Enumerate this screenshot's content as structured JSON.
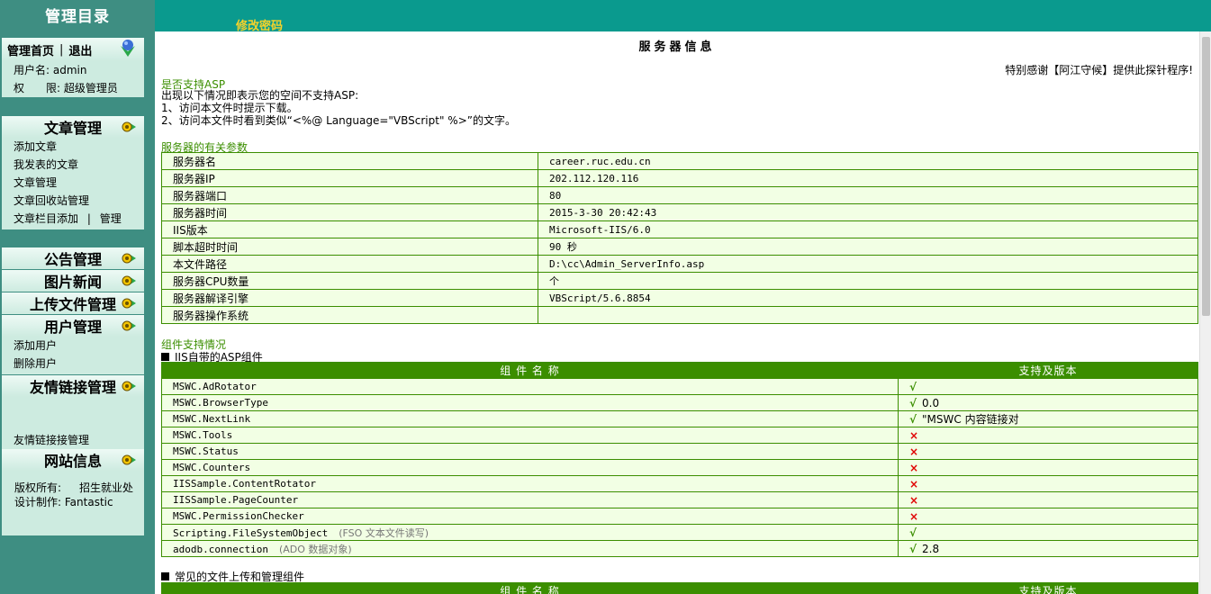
{
  "sidebar": {
    "title": "管理目录",
    "home_link": "管理首页",
    "separator": "|",
    "logout_link": "退出",
    "user_line": "用户名: admin",
    "perm_label": "权　　限: 超级管理员",
    "article_head": "文章管理",
    "article_items": [
      "添加文章",
      "我发表的文章",
      "文章管理",
      "文章回收站管理"
    ],
    "article_col_add": "文章栏目添加",
    "article_col_manage": "管理",
    "notice_head": "公告管理",
    "photo_head": "图片新闻",
    "upload_head": "上传文件管理",
    "user_head": "用户管理",
    "user_items": [
      "添加用户",
      "删除用户"
    ],
    "link_head": "友情链接管理",
    "link_items": [
      "友情链接接管理"
    ],
    "site_head": "网站信息",
    "copyright_label": "版权所有:",
    "copyright_value": "招生就业处",
    "design_label": "设计制作:",
    "design_value": "Fantastic"
  },
  "topbar": {
    "change_password": "修改密码"
  },
  "main": {
    "title": "服务器信息",
    "thanks": "特别感谢【阿江守候】提供此探针程序!",
    "asp_title": "是否支持ASP",
    "asp_lines": [
      "出现以下情况即表示您的空间不支持ASP:",
      "1、访问本文件时提示下载。",
      "2、访问本文件时看到类似“<%@ Language=\"VBScript\" %>”的文字。"
    ],
    "params_title": "服务器的有关参数",
    "params": [
      {
        "name": "服务器名",
        "value": "career.ruc.edu.cn"
      },
      {
        "name": "服务器IP",
        "value": "202.112.120.116"
      },
      {
        "name": "服务器端口",
        "value": "80"
      },
      {
        "name": "服务器时间",
        "value": "2015-3-30 20:42:43"
      },
      {
        "name": "IIS版本",
        "value": "Microsoft-IIS/6.0"
      },
      {
        "name": "脚本超时时间",
        "value": "90 秒"
      },
      {
        "name": "本文件路径",
        "value": "D:\\cc\\Admin_ServerInfo.asp"
      },
      {
        "name": "服务器CPU数量",
        "value": " 个"
      },
      {
        "name": "服务器解译引擎",
        "value": "VBScript/5.6.8854"
      },
      {
        "name": "服务器操作系统",
        "value": ""
      }
    ],
    "components_title": "组件支持情况",
    "iis_sub": "IIS自带的ASP组件",
    "col_name": "组 件 名 称",
    "col_support": "支持及版本",
    "components": [
      {
        "name": "MSWC.AdRotator",
        "note": "",
        "supported": true,
        "version": ""
      },
      {
        "name": "MSWC.BrowserType",
        "note": "",
        "supported": true,
        "version": "0.0"
      },
      {
        "name": "MSWC.NextLink",
        "note": "",
        "supported": true,
        "version": "\"MSWC 内容链接对"
      },
      {
        "name": "MSWC.Tools",
        "note": "",
        "supported": false,
        "version": ""
      },
      {
        "name": "MSWC.Status",
        "note": "",
        "supported": false,
        "version": ""
      },
      {
        "name": "MSWC.Counters",
        "note": "",
        "supported": false,
        "version": ""
      },
      {
        "name": "IISSample.ContentRotator",
        "note": "",
        "supported": false,
        "version": ""
      },
      {
        "name": "IISSample.PageCounter",
        "note": "",
        "supported": false,
        "version": ""
      },
      {
        "name": "MSWC.PermissionChecker",
        "note": "",
        "supported": false,
        "version": ""
      },
      {
        "name": "Scripting.FileSystemObject",
        "note": "(FSO 文本文件读写)",
        "supported": true,
        "version": ""
      },
      {
        "name": "adodb.connection",
        "note": "(ADO 数据对象)",
        "supported": true,
        "version": "2.8"
      }
    ],
    "upload_sub": "常见的文件上传和管理组件",
    "check_symbol": "√",
    "cross_symbol": "×"
  },
  "icons": {
    "gear": "gear-icon",
    "globe": "globe-icon"
  },
  "colors": {
    "sidebar_bg": "#3e8e82",
    "topbar_bg": "#0a9a8e",
    "table_border": "#3b8e00",
    "cell_bg": "#f2ffe4",
    "link_yellow": "#f4d22b"
  }
}
